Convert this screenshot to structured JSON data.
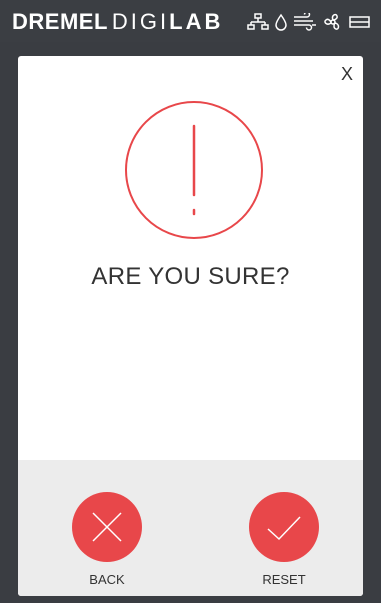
{
  "header": {
    "brand_part1": "DREMEL",
    "brand_part2": "DIGI",
    "brand_part3": "LAB",
    "status_icons": [
      "network-icon",
      "filament-drop-icon",
      "airflow-icon",
      "fan-icon",
      "battery-icon"
    ]
  },
  "dialog": {
    "close_label": "X",
    "question": "ARE YOU SURE?",
    "back_label": "BACK",
    "reset_label": "RESET"
  },
  "colors": {
    "accent": "#e8474a",
    "header_bg": "#3b3e43",
    "footer_bg": "#ececec"
  }
}
